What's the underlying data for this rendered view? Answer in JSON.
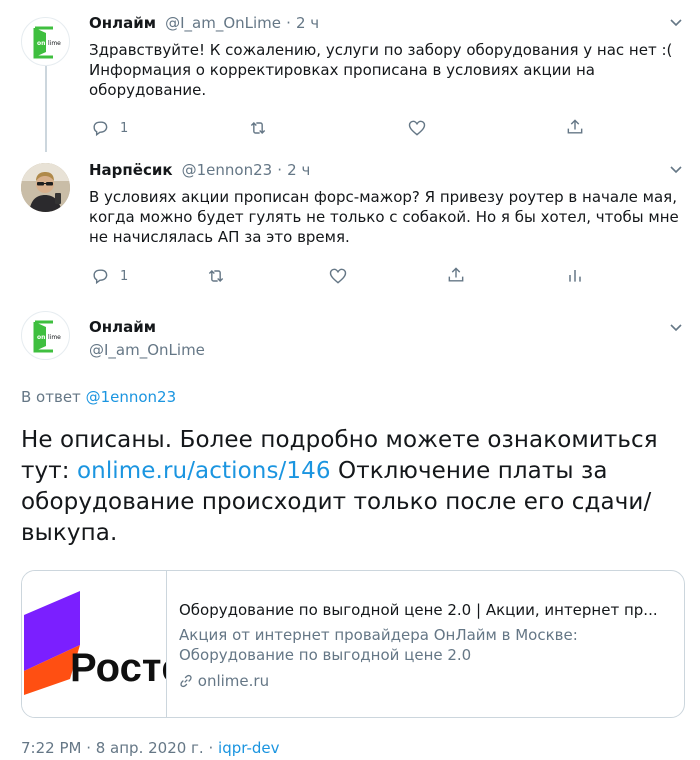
{
  "tweet1": {
    "name": "Онлайм",
    "handle": "@I_am_OnLime",
    "sep": "·",
    "time": "2 ч",
    "text": "Здравствуйте! К сожалению, услуги по забору оборудования у нас нет :( Информация о корректировках прописана в условиях акции на оборудование.",
    "reply_count": "1",
    "avatar_text": {
      "on": "on",
      "lime": "lime"
    }
  },
  "tweet2": {
    "name": "Нарпёсик",
    "handle": "@1ennon23",
    "sep": "·",
    "time": "2 ч",
    "text": "В условиях акции прописан форс-мажор? Я привезу роутер в начале мая, когда можно будет гулять не только с собакой. Но я бы хотел, чтобы мне не начислялась АП за это время.",
    "reply_count": "1"
  },
  "main": {
    "name": "Онлайм",
    "handle": "@I_am_OnLime",
    "reply_to_prefix": "В ответ",
    "reply_to_handle": "@1ennon23",
    "text_before": "Не описаны. Более подробно можете ознакомиться тут: ",
    "link": "onlime.ru/actions/146",
    "text_after": " Отключение платы за оборудование происходит только после его сдачи/выкупа.",
    "card": {
      "logo_text": "Ростел",
      "title": "Оборудование по выгодной цене 2.0 | Акции, интернет пр...",
      "description": "Акция от интернет провайдера ОнЛайм в Москве: Оборудование по выгодной цене 2.0",
      "domain": "onlime.ru"
    },
    "timestamp": "7:22 PM · 8 апр. 2020 г. ·",
    "app": "iqpr-dev"
  },
  "colors": {
    "accent": "#1b95e0",
    "muted": "#657786",
    "onlime_green": "#3fbf3f",
    "rt_purple": "#7b1fff",
    "rt_orange": "#ff4f12"
  }
}
